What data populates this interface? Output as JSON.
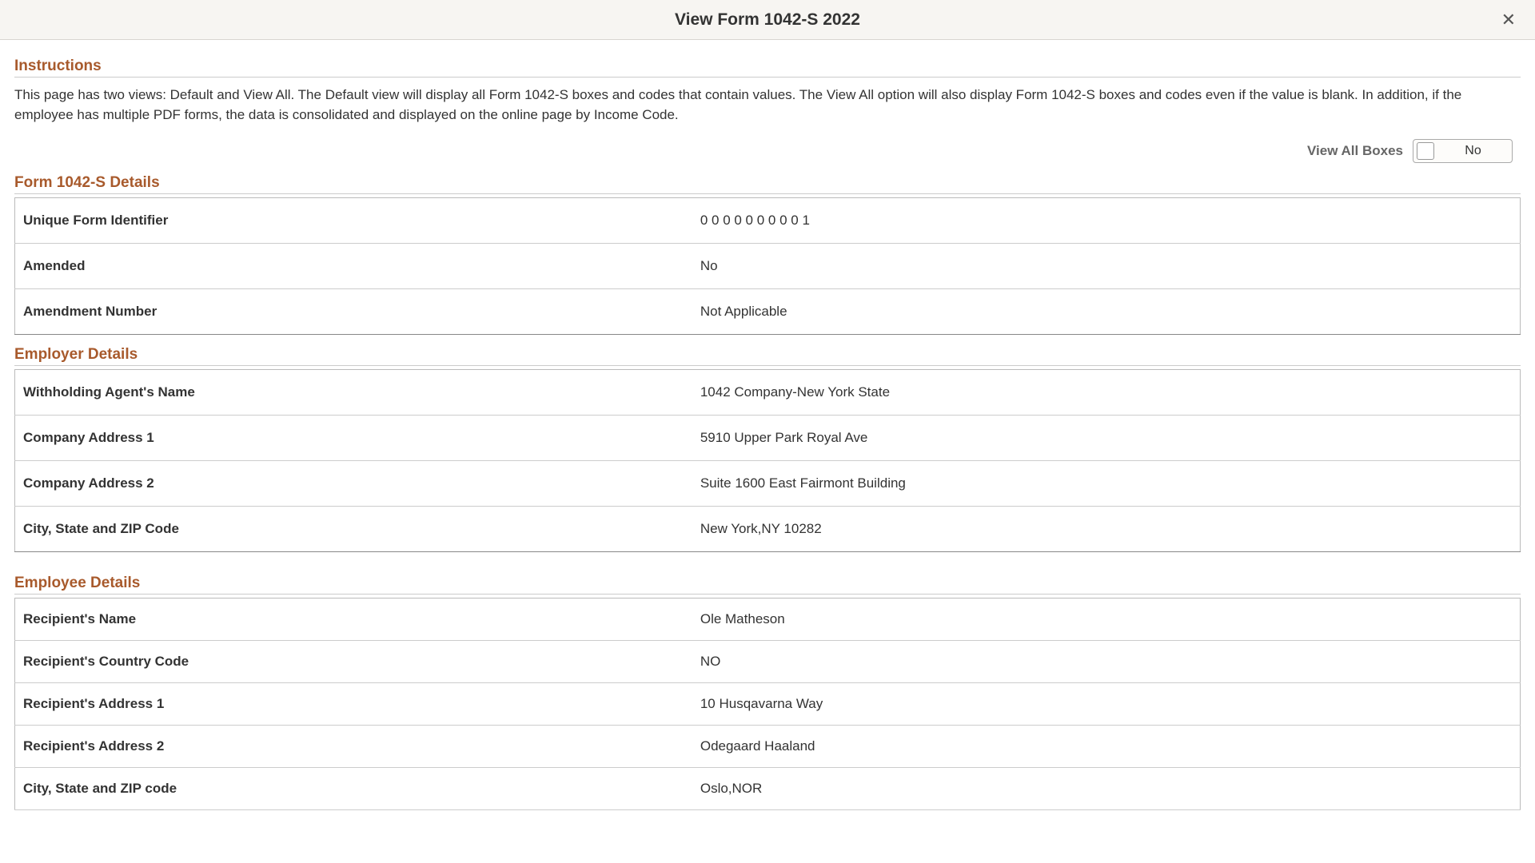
{
  "header": {
    "title": "View Form 1042-S 2022"
  },
  "instructions": {
    "heading": "Instructions",
    "text": "This page has two views: Default and View All.  The Default view will display all Form 1042-S boxes and codes that contain values. The View All option will also display Form 1042-S boxes and codes even if the value is blank. In addition, if the employee has multiple PDF forms, the data is consolidated and displayed on the online page by Income Code."
  },
  "viewAll": {
    "label": "View All Boxes",
    "value": "No"
  },
  "formDetails": {
    "heading": "Form 1042-S Details",
    "rows": [
      {
        "label": "Unique Form Identifier",
        "value": "0 0 0 0 0 0 0 0 0 1"
      },
      {
        "label": "Amended",
        "value": "No"
      },
      {
        "label": "Amendment Number",
        "value": "Not Applicable"
      }
    ]
  },
  "employerDetails": {
    "heading": "Employer Details",
    "rows": [
      {
        "label": "Withholding Agent's Name",
        "value": "1042 Company-New York State"
      },
      {
        "label": "Company Address 1",
        "value": "5910 Upper Park Royal Ave"
      },
      {
        "label": "Company Address 2",
        "value": "Suite 1600 East Fairmont Building"
      },
      {
        "label": "City, State and ZIP Code",
        "value": "New York,NY 10282"
      }
    ]
  },
  "employeeDetails": {
    "heading": "Employee Details",
    "rows": [
      {
        "label": "Recipient's Name",
        "value": "Ole Matheson"
      },
      {
        "label": "Recipient's Country Code",
        "value": "NO"
      },
      {
        "label": "Recipient's Address 1",
        "value": "10 Husqavarna Way"
      },
      {
        "label": "Recipient's Address 2",
        "value": "Odegaard Haaland"
      },
      {
        "label": "City, State and ZIP code",
        "value": "Oslo,NOR"
      }
    ]
  }
}
